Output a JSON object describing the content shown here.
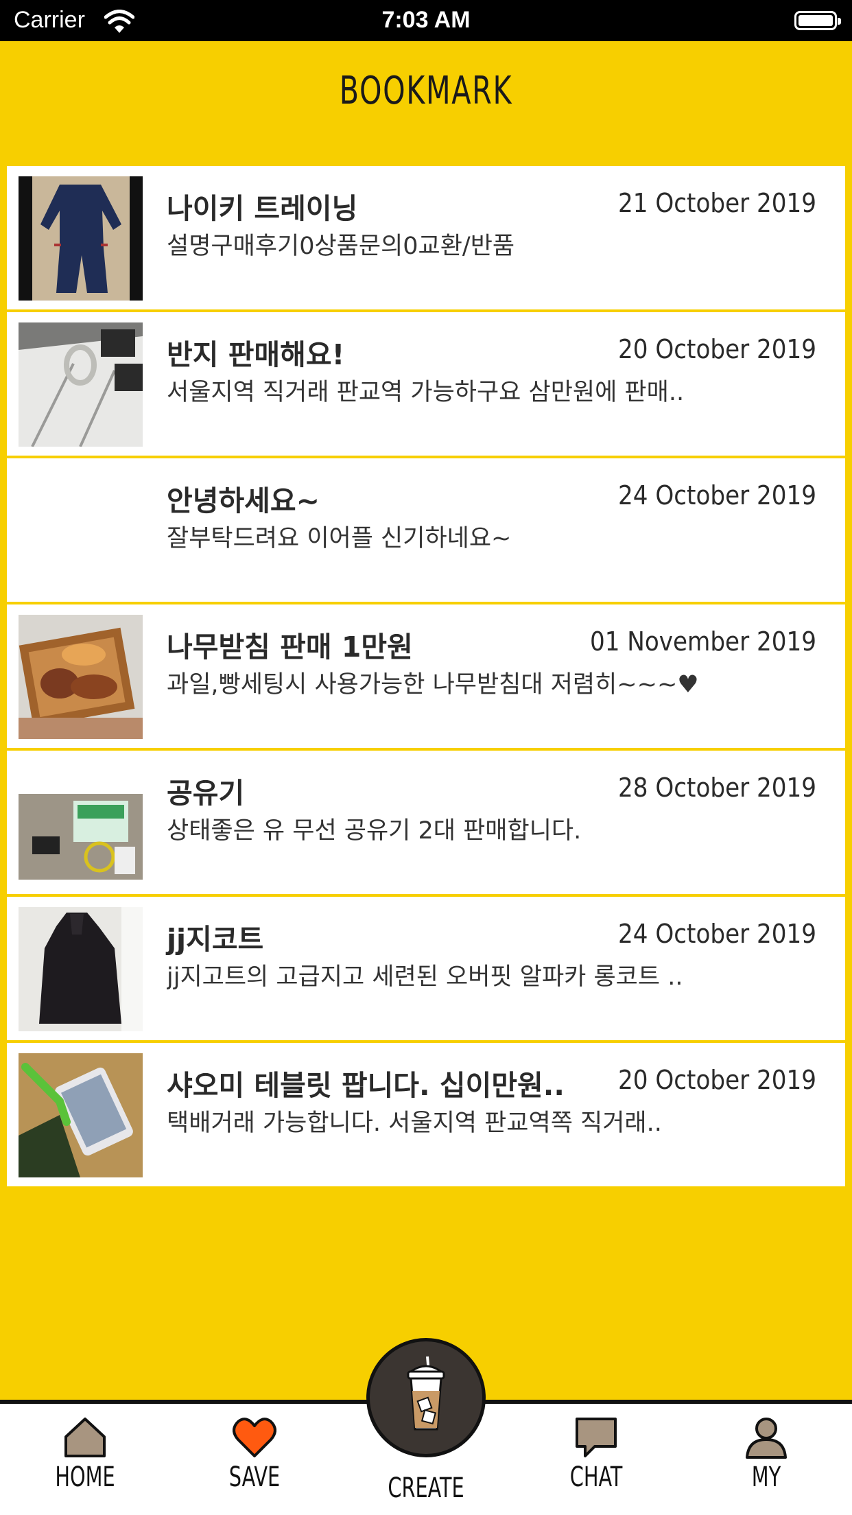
{
  "status_bar": {
    "carrier": "Carrier",
    "time": "7:03 AM"
  },
  "header": {
    "title": "BOOKMARK"
  },
  "items": [
    {
      "title": "나이키 트레이닝",
      "desc": "설명구매후기0상품문의0교환/반품",
      "date": "21 October 2019",
      "thumb": "tracksuit"
    },
    {
      "title": "반지 판매해요!",
      "desc": "서울지역 직거래  판교역 가능하구요 삼만원에  판매..",
      "date": "20 October 2019",
      "thumb": "ring"
    },
    {
      "title": "안녕하세요~",
      "desc": "잘부탁드려요 이어플 신기하네요~",
      "date": "24 October 2019",
      "thumb": "none"
    },
    {
      "title": "나무받침 판매 1만원",
      "desc": "과일,빵세팅시 사용가능한 나무받침대 저렴히~~~♥",
      "date": "01 November 2019",
      "thumb": "tray"
    },
    {
      "title": "공유기",
      "desc": "상태좋은 유 무선 공유기 2대 판매합니다.",
      "date": "28 October 2019",
      "thumb": "router"
    },
    {
      "title": "jj지코트",
      "desc": "jj지고트의 고급지고 세련된 오버핏 알파카 롱코트 ..",
      "date": "24 October 2019",
      "thumb": "coat"
    },
    {
      "title": "샤오미 테블릿  팝니다. 십이만원..",
      "desc": "택배거래  가능합니다. 서울지역  판교역쪽  직거래..",
      "date": "20 October 2019",
      "thumb": "tablet"
    }
  ],
  "tabbar": {
    "home": "HOME",
    "save": "SAVE",
    "create": "CREATE",
    "chat": "CHAT",
    "my": "MY"
  },
  "colors": {
    "background": "#F7CF00",
    "heart": "#FF5A10",
    "icon_fill": "#A89580",
    "dark": "#3b3531"
  }
}
